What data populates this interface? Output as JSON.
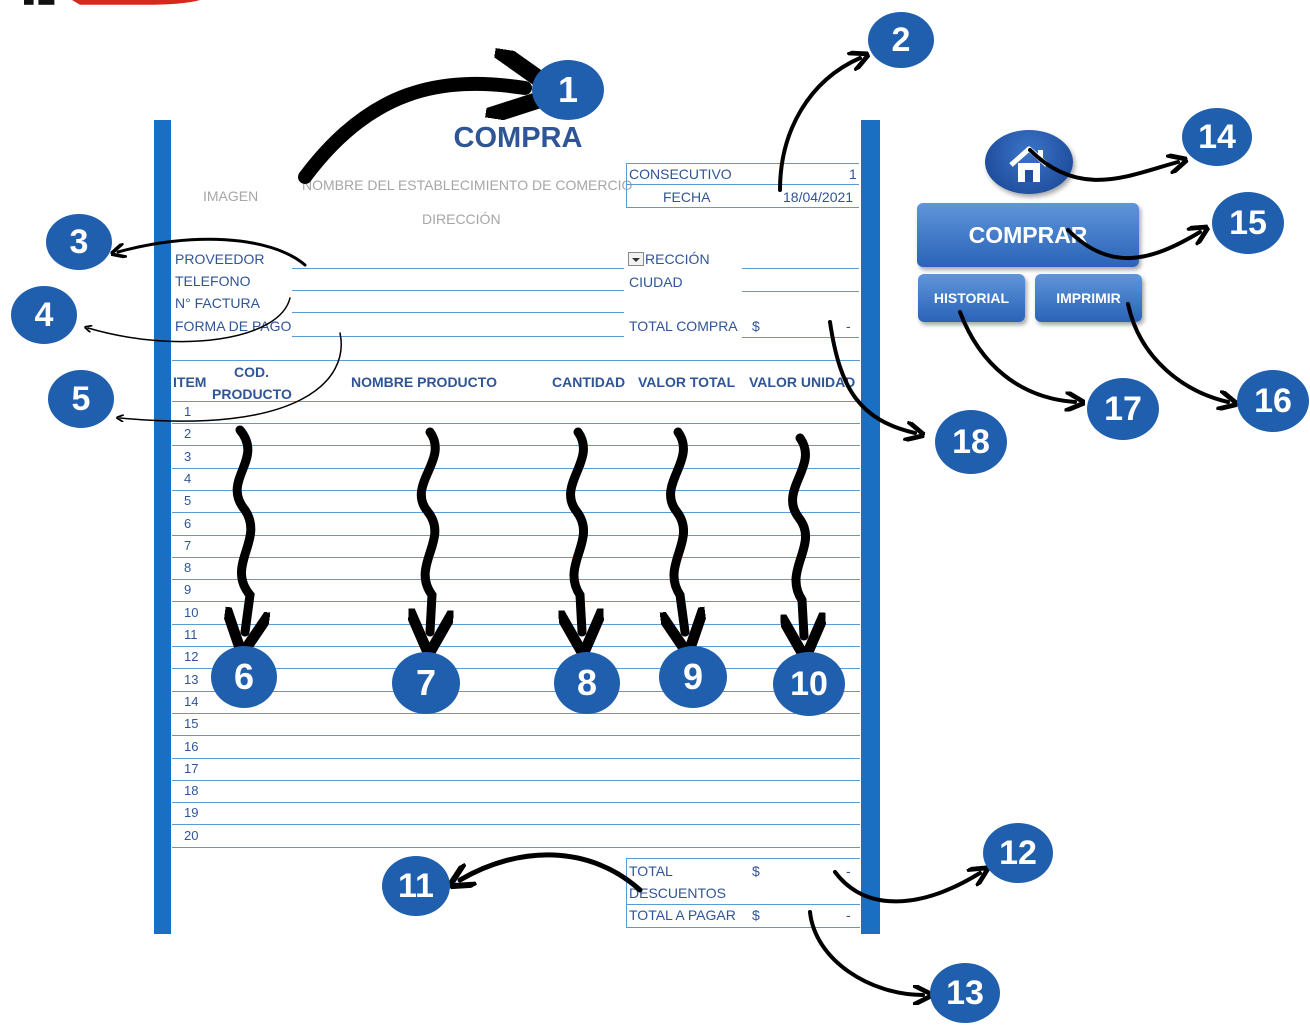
{
  "form": {
    "title": "COMPRA",
    "imagen": "IMAGEN",
    "establecimiento": "NOMBRE DEL ESTABLECIMIENTO DE COMERCIO",
    "direccion_header": "DIRECCIÓN",
    "consecutivo_label": "CONSECUTIVO",
    "consecutivo_value": "1",
    "fecha_label": "FECHA",
    "fecha_value": "18/04/2021",
    "proveedor_label": "PROVEEDOR",
    "telefono_label": "TELEFONO",
    "factura_label": "N° FACTURA",
    "forma_pago_label": "FORMA DE PAGO",
    "direccion_label": "RECCIÓN",
    "ciudad_label": "CIUDAD",
    "total_compra_label": "TOTAL COMPRA",
    "total_compra_currency": "$",
    "total_compra_value": "-"
  },
  "table": {
    "headers": {
      "item": "ITEM",
      "cod_line1": "COD.",
      "cod_line2": "PRODUCTO",
      "nombre": "NOMBRE PRODUCTO",
      "cantidad": "CANTIDAD",
      "valor_total": "VALOR TOTAL",
      "valor_unidad": "VALOR UNIDAD"
    },
    "rows": [
      "1",
      "2",
      "3",
      "4",
      "5",
      "6",
      "7",
      "8",
      "9",
      "10",
      "11",
      "12",
      "13",
      "14",
      "15",
      "16",
      "17",
      "18",
      "19",
      "20"
    ]
  },
  "totals": {
    "total_label": "TOTAL",
    "total_currency": "$",
    "total_value": "-",
    "descuentos_label": "DESCUENTOS",
    "total_pagar_label": "TOTAL A PAGAR",
    "total_pagar_currency": "$",
    "total_pagar_value": "-"
  },
  "buttons": {
    "comprar": "COMPRAR",
    "historial": "HISTORIAL",
    "imprimir": "IMPRIMIR",
    "home_icon": "home-icon",
    "dropdown_icon": "dropdown-arrow-icon"
  },
  "callouts": [
    "1",
    "2",
    "3",
    "4",
    "5",
    "6",
    "7",
    "8",
    "9",
    "10",
    "11",
    "12",
    "13",
    "14",
    "15",
    "16",
    "17",
    "18"
  ],
  "colors": {
    "sidebar_blue": "#1a6fc2",
    "label_blue": "#2f5597",
    "callout_blue": "#1f5fad"
  }
}
